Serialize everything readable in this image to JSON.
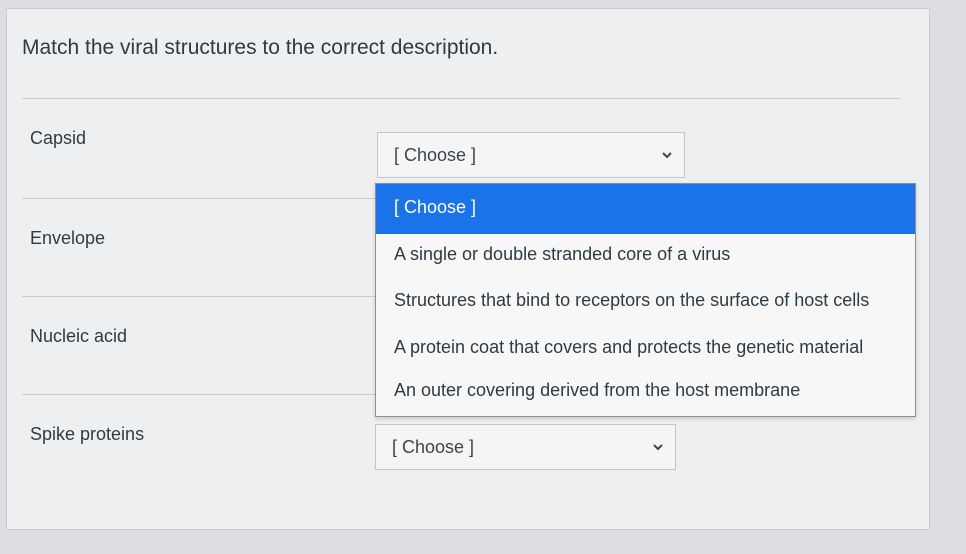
{
  "question": {
    "prompt": "Match the viral structures to the correct description."
  },
  "items": [
    {
      "label": "Capsid",
      "selected": "[ Choose ]"
    },
    {
      "label": "Envelope"
    },
    {
      "label": "Nucleic acid"
    },
    {
      "label": "Spike proteins",
      "selected": "[ Choose ]"
    }
  ],
  "dropdown": {
    "options": [
      "[ Choose ]",
      "A single or double stranded core of a virus",
      "Structures that bind to receptors on the surface of host cells",
      "A protein coat that covers and protects the genetic material",
      "An outer covering derived from the host membrane"
    ],
    "highlight_color": "#1a73e8"
  },
  "icons": {
    "chevron": "chevron-down-icon"
  }
}
